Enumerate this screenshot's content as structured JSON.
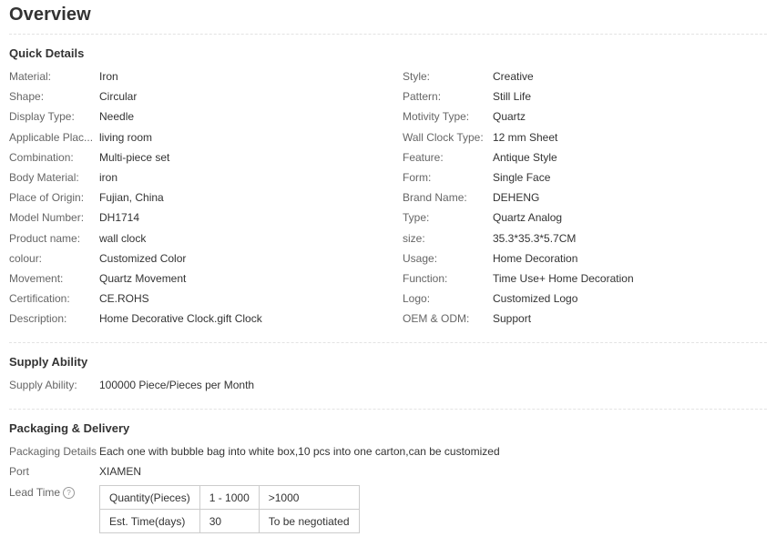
{
  "page_title": "Overview",
  "quick_details": {
    "heading": "Quick Details",
    "left": [
      {
        "label": "Material:",
        "value": "Iron"
      },
      {
        "label": "Shape:",
        "value": "Circular"
      },
      {
        "label": "Display Type:",
        "value": "Needle"
      },
      {
        "label": "Applicable Plac...",
        "value": "living room"
      },
      {
        "label": "Combination:",
        "value": "Multi-piece set"
      },
      {
        "label": "Body Material:",
        "value": "iron"
      },
      {
        "label": "Place of Origin:",
        "value": "Fujian, China"
      },
      {
        "label": "Model Number:",
        "value": "DH1714"
      },
      {
        "label": "Product name:",
        "value": "wall clock"
      },
      {
        "label": "colour:",
        "value": "Customized Color"
      },
      {
        "label": "Movement:",
        "value": "Quartz Movement"
      },
      {
        "label": "Certification:",
        "value": "CE.ROHS"
      },
      {
        "label": "Description:",
        "value": "Home Decorative Clock.gift Clock"
      }
    ],
    "right": [
      {
        "label": "Style:",
        "value": "Creative"
      },
      {
        "label": "Pattern:",
        "value": "Still Life"
      },
      {
        "label": "Motivity Type:",
        "value": "Quartz"
      },
      {
        "label": "Wall Clock Type:",
        "value": "12 mm Sheet"
      },
      {
        "label": "Feature:",
        "value": "Antique Style"
      },
      {
        "label": "Form:",
        "value": "Single Face"
      },
      {
        "label": "Brand Name:",
        "value": "DEHENG"
      },
      {
        "label": "Type:",
        "value": "Quartz Analog"
      },
      {
        "label": "size:",
        "value": "35.3*35.3*5.7CM"
      },
      {
        "label": "Usage:",
        "value": "Home Decoration"
      },
      {
        "label": "Function:",
        "value": "Time Use+ Home Decoration"
      },
      {
        "label": "Logo:",
        "value": "Customized Logo"
      },
      {
        "label": "OEM & ODM:",
        "value": "Support"
      }
    ]
  },
  "supply_ability": {
    "heading": "Supply Ability",
    "label": "Supply Ability:",
    "value": "100000 Piece/Pieces per Month"
  },
  "packaging": {
    "heading": "Packaging & Delivery",
    "details_label": "Packaging Details",
    "details_value": "Each one with bubble bag into white box,10 pcs into one carton,can be customized",
    "port_label": "Port",
    "port_value": "XIAMEN",
    "lead_time_label": "Lead Time",
    "help_icon": "question-circle-icon",
    "help_glyph": "?",
    "lead_table": [
      [
        "Quantity(Pieces)",
        "1 - 1000",
        ">1000"
      ],
      [
        "Est. Time(days)",
        "30",
        "To be negotiated"
      ]
    ]
  }
}
